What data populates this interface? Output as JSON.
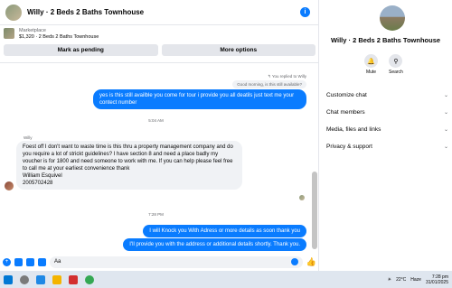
{
  "header": {
    "title": "Willy · 2 Beds 2 Baths Townhouse",
    "info_icon": "i"
  },
  "listing": {
    "source": "Marketplace",
    "summary": "$1,320 · 2 Beds 2 Baths Townhouse",
    "mark_pending": "Mark as pending",
    "more_options": "More options"
  },
  "messages": {
    "reply_note": "↰ You replied to Willy",
    "quoted": "Good morning, is this still available?",
    "out1": "yes  is this still availble you come for tour i provide you all deatils  just text me your contect number",
    "time1": "5:04 AM",
    "sender": "Willy",
    "in1": "Foest off I don't want to waste time is this thru a property management company and do you require a lot of strickt guidelines? I have section 8 and need a place badly my voucher is for 1800 and need someone to work with me.  If you can help please feel free to call me at your earliest convenience thank",
    "in1_name": "William Esquivel",
    "in1_phone": "2005702428",
    "time2": "7:28 PM",
    "out2": "I will Knock you With Adress or more details  as soon thank you",
    "out3": "I'll provide you with the address or additional details shortly. Thank you."
  },
  "composer": {
    "value": "Aa"
  },
  "side": {
    "title": "Willy · 2 Beds 2 Baths Townhouse",
    "mute": "Mute",
    "search": "Search",
    "menu": [
      "Customize chat",
      "Chat members",
      "Media, files and links",
      "Privacy & support"
    ]
  },
  "taskbar": {
    "temp": "22°C",
    "weather": "Haze",
    "time": "7:28 pm",
    "date": "31/01/2025"
  },
  "colors": {
    "accent": "#0a7cff",
    "bubble_in": "#f0f2f5"
  }
}
